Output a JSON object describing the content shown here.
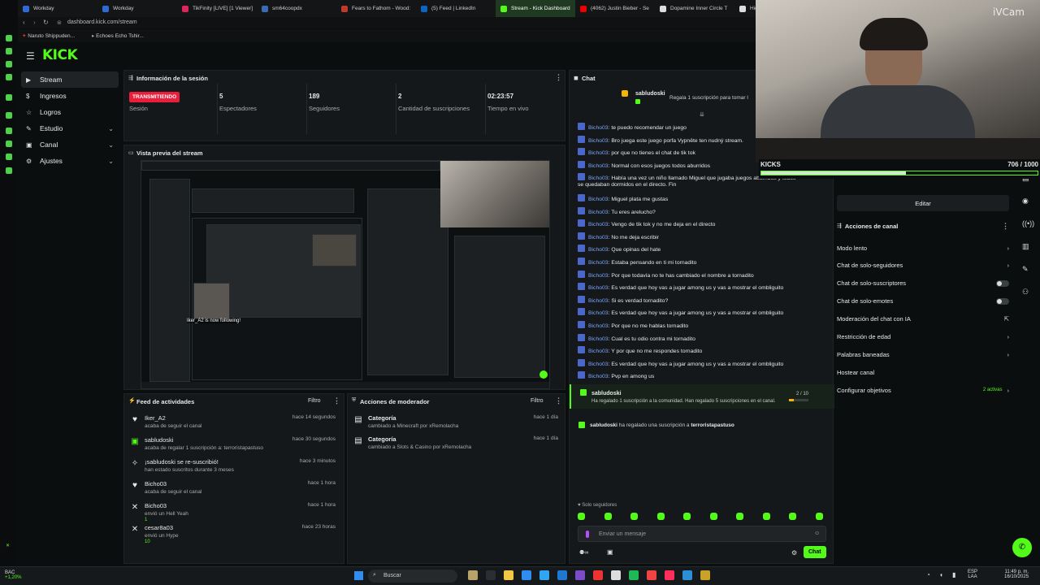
{
  "browser": {
    "tabs": [
      {
        "label": "Workday",
        "color": "#2d6ad8"
      },
      {
        "label": "Workday",
        "color": "#2d6ad8"
      },
      {
        "label": "TikFinity [LIVE] [1 Viewer]",
        "color": "#e0245e"
      },
      {
        "label": "sm64coopdx",
        "color": "#3a6bb5"
      },
      {
        "label": "Fears to Fathom - Wood:",
        "color": "#c0392b"
      },
      {
        "label": "(5) Feed | LinkedIn",
        "color": "#0a66c2"
      },
      {
        "label": "Stream - Kick Dashboard",
        "color": "#53fc18",
        "active": true
      },
      {
        "label": "(4062) Justin Bieber - Se",
        "color": "#e00"
      },
      {
        "label": "Dopamine Inner Circle T",
        "color": "#ddd"
      },
      {
        "label": "Hig",
        "color": "#ddd"
      }
    ],
    "url": "dashboard.kick.com/stream",
    "bookmarks": [
      "Naruto Shippuden...",
      "Echoes Echo Tshir..."
    ]
  },
  "webcam": {
    "watermark": "iVCam"
  },
  "app": {
    "logo": "KICK"
  },
  "sidebar": {
    "items": [
      {
        "label": "Stream",
        "active": true
      },
      {
        "label": "Ingresos"
      },
      {
        "label": "Logros"
      },
      {
        "label": "Estudio",
        "expand": true
      },
      {
        "label": "Canal",
        "expand": true
      },
      {
        "label": "Ajustes",
        "expand": true
      }
    ]
  },
  "session": {
    "title": "Información de la sesión",
    "status": "TRANSMITIENDO",
    "status_label": "Sesión",
    "stats": [
      {
        "value": "5",
        "label": "Espectadores"
      },
      {
        "value": "189",
        "label": "Seguidores"
      },
      {
        "value": "2",
        "label": "Cantidad de suscripciones"
      },
      {
        "value": "02:23:57",
        "label": "Tiempo en vivo"
      }
    ]
  },
  "preview": {
    "title": "Vista previa del stream",
    "overlay_text": "Iker_A2 is now following!"
  },
  "activity": {
    "title": "Feed de actividades",
    "filter": "Filtro",
    "items": [
      {
        "icon": "heart",
        "name": "Iker_A2",
        "sub": "acaba de seguir el canal",
        "time": "hace 14 segundos"
      },
      {
        "icon": "gift",
        "name": "sabludoski",
        "sub": "acaba de regalar 1 suscripción a: terroristapastuso",
        "time": "hace 30 segundos"
      },
      {
        "icon": "star",
        "name": "¡sabludoski se re-suscribió!",
        "sub": "han estado suscritos durante 3 meses",
        "time": "hace 3 minutos"
      },
      {
        "icon": "heart",
        "name": "Bicho03",
        "sub": "acaba de seguir el canal",
        "time": "hace 1 hora"
      },
      {
        "icon": "kicks",
        "name": "Bicho03",
        "sub": "envió un Hell Yeah",
        "extra": "1",
        "time": "hace 1 hora"
      },
      {
        "icon": "kicks",
        "name": "cesar8a03",
        "sub": "envió un Hype",
        "extra": "10",
        "time": "hace 23 horas"
      }
    ]
  },
  "modactions": {
    "title": "Acciones de moderador",
    "filter": "Filtro",
    "items": [
      {
        "name": "Categoría",
        "sub": "cambiado a Minecraft por xRemolacha",
        "time": "hace 1 día"
      },
      {
        "name": "Categoría",
        "sub": "cambiado a Slots & Casino por xRemolacha",
        "time": "hace 1 día"
      }
    ]
  },
  "chat": {
    "title": "Chat",
    "pinned_user": "sabludoski",
    "pinned_text": "Regala 1 suscripción para tomar l",
    "messages": [
      {
        "user": "Bicho03",
        "text": "te puedo recomendar un juego"
      },
      {
        "user": "Bicho03",
        "text": "Bro juega este juego porfa Vypnête ten nudný stream."
      },
      {
        "user": "Bicho03",
        "text": "por que no tienes el chat de tik tok"
      },
      {
        "user": "Bicho03",
        "text": "Normal con esos juegos todos aburridos"
      },
      {
        "user": "Bicho03",
        "text": "Había una vez un niño llamado Miguel que jugaba juegos aburridos y todos",
        "cont": "se quedaban dormidos en el directo. Fin"
      },
      {
        "user": "Bicho03",
        "text": "Miguel plata me gustas"
      },
      {
        "user": "Bicho03",
        "text": "Tu eres arelucho?"
      },
      {
        "user": "Bicho03",
        "text": "Vengo de tik tok y no me deja en el directo"
      },
      {
        "user": "Bicho03",
        "text": "No me deja escribir"
      },
      {
        "user": "Bicho03",
        "text": "Que opinas del hate"
      },
      {
        "user": "Bicho03",
        "text": "Estaba pensando en ti mi tornadito"
      },
      {
        "user": "Bicho03",
        "text": "Por que todavía no te has cambiado el nombre a tornadito"
      },
      {
        "user": "Bicho03",
        "text": "Es verdad que hoy vas a jugar among us y vas a mostrar el ombliguito"
      },
      {
        "user": "Bicho03",
        "text": "Si es verdad tornadito?"
      },
      {
        "user": "Bicho03",
        "text": "Es verdad que hoy vas a jugar among us y vas a mostrar el ombliguito"
      },
      {
        "user": "Bicho03",
        "text": "Por que no me hablas tornadito"
      },
      {
        "user": "Bicho03",
        "text": "Cual es tu odio contra mi tornadito"
      },
      {
        "user": "Bicho03",
        "text": "Y por que no me respondes tornadito"
      },
      {
        "user": "Bicho03",
        "text": "Es verdad que hoy vas a jugar among us y vas a mostrar el ombliguito"
      },
      {
        "user": "Bicho03",
        "text": "Pvp en among us"
      }
    ],
    "gift_user": "sabludoski",
    "gift_text": "Ha regalado 1 suscripción a la comunidad. Han regalado 5 suscripciones en el canal.",
    "gift_count": "2 / 10",
    "gift2_user": "sabludoski",
    "gift2_text": "ha regalado una suscripción a",
    "gift2_target": "terroristapastuso",
    "followers_only": "Solo seguidores",
    "placeholder": "Enviar un mensaje",
    "send": "Chat"
  },
  "kicks_widget": {
    "label": "KICKS",
    "value": "706 / 1000",
    "progress": 0.706
  },
  "channel": {
    "edit": "Editar",
    "title": "Acciones de canal",
    "actions": [
      {
        "label": "Modo lento",
        "type": "arrow"
      },
      {
        "label": "Chat de solo-seguidores",
        "type": "arrow"
      },
      {
        "label": "Chat de solo-suscriptores",
        "type": "toggle"
      },
      {
        "label": "Chat de solo-emotes",
        "type": "toggle"
      },
      {
        "label": "Moderación del chat con IA",
        "type": "external"
      },
      {
        "label": "Restricción de edad",
        "type": "arrow"
      },
      {
        "label": "Palabras baneadas",
        "type": "arrow"
      },
      {
        "label": "Hostear canal",
        "type": "none"
      },
      {
        "label": "Configurar objetivos",
        "type": "arrow",
        "extra": "2 activas"
      }
    ]
  },
  "taskbar": {
    "weather_temp": "BAC",
    "weather_change": "+1,20%",
    "search": "Buscar",
    "lang": "ESP",
    "lang2": "LAA",
    "time": "11:49 p. m.",
    "date": "16/10/2025"
  }
}
